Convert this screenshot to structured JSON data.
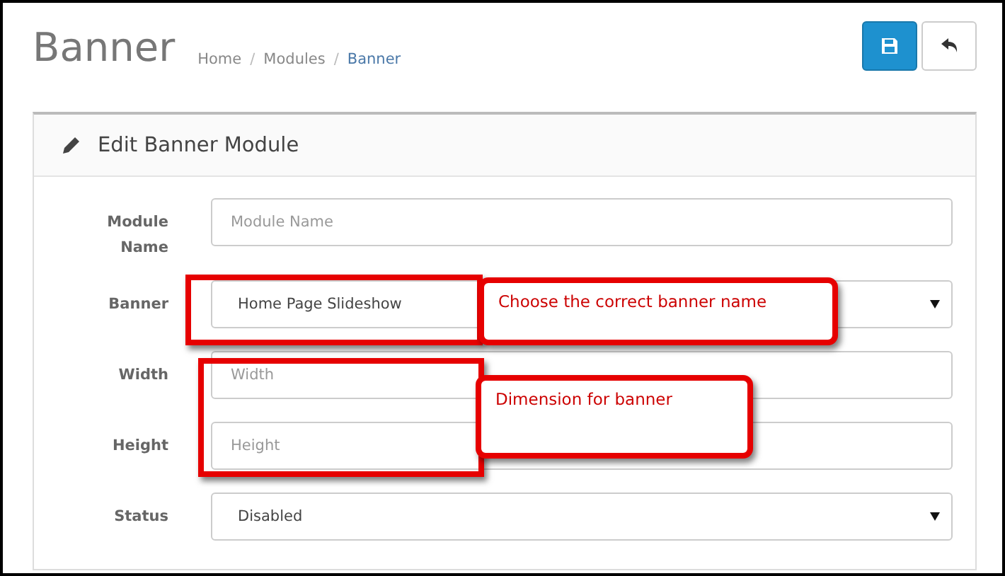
{
  "page": {
    "title": "Banner"
  },
  "breadcrumb": [
    {
      "label": "Home",
      "current": false
    },
    {
      "label": "Modules",
      "current": false
    },
    {
      "label": "Banner",
      "current": true
    }
  ],
  "breadcrumb_separators": [
    "/",
    "/"
  ],
  "panel": {
    "title": "Edit Banner Module"
  },
  "fields": [
    {
      "label": "Module Name",
      "kind": "text",
      "placeholder": "Module Name"
    },
    {
      "label": "Banner",
      "kind": "select",
      "value": "Home Page Slideshow"
    },
    {
      "label": "Width",
      "kind": "text",
      "placeholder": "Width"
    },
    {
      "label": "Height",
      "kind": "text",
      "placeholder": "Height"
    },
    {
      "label": "Status",
      "kind": "select",
      "value": "Disabled"
    }
  ],
  "annotations": [
    {
      "text": "Choose the correct banner name"
    },
    {
      "text": "Dimension for banner"
    }
  ]
}
